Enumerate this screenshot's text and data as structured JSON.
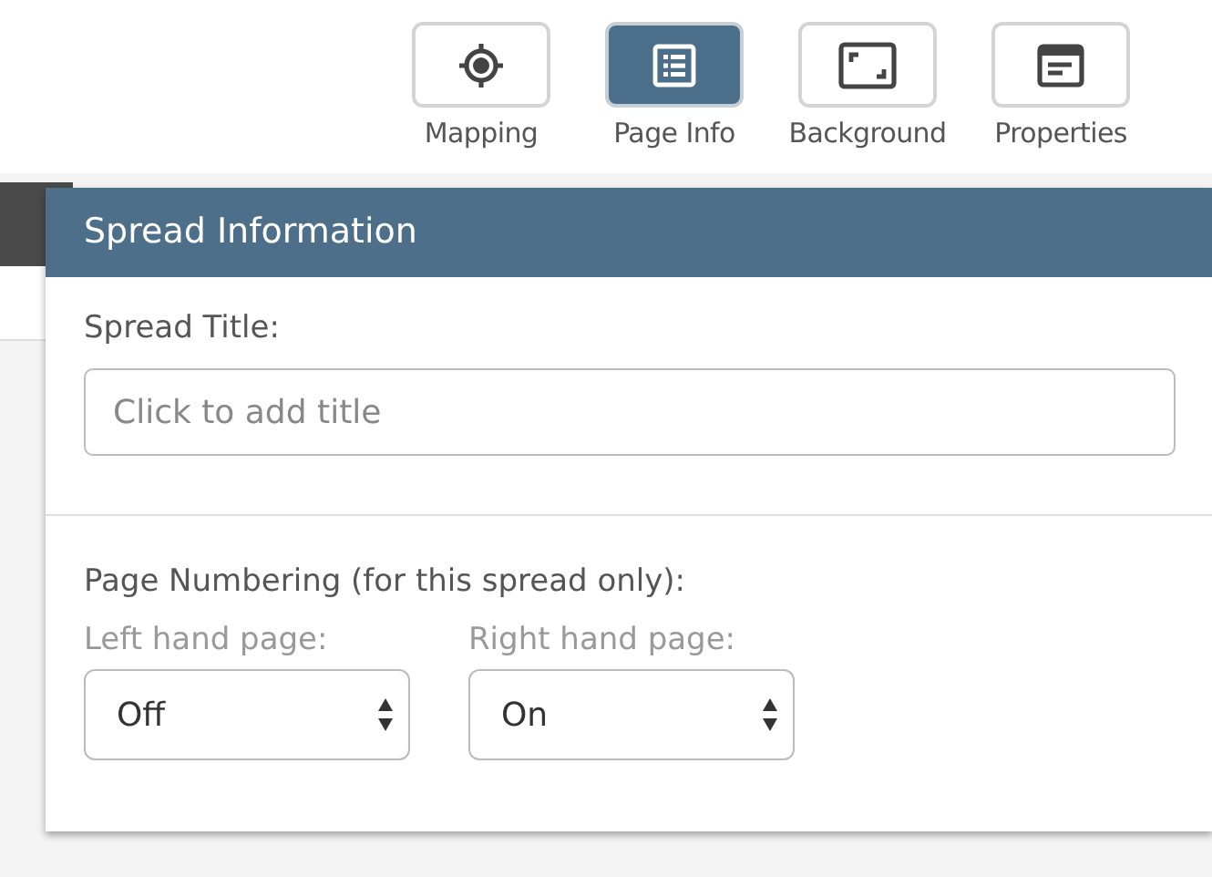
{
  "toolbar": [
    {
      "kind": "target",
      "label": "Mapping",
      "selected": false
    },
    {
      "kind": "list",
      "label": "Page Info",
      "selected": true
    },
    {
      "kind": "frame",
      "label": "Background",
      "selected": false
    },
    {
      "kind": "window",
      "label": "Properties",
      "selected": false
    }
  ],
  "panel": {
    "title": "Spread Information",
    "title_field": {
      "label": "Spread Title:",
      "placeholder": "Click to add title"
    },
    "numbering": {
      "label": "Page Numbering (for this spread only):",
      "selects": [
        {
          "label": "Left hand page:",
          "value": "Off"
        },
        {
          "label": "Right hand page:",
          "value": "On"
        }
      ]
    }
  }
}
